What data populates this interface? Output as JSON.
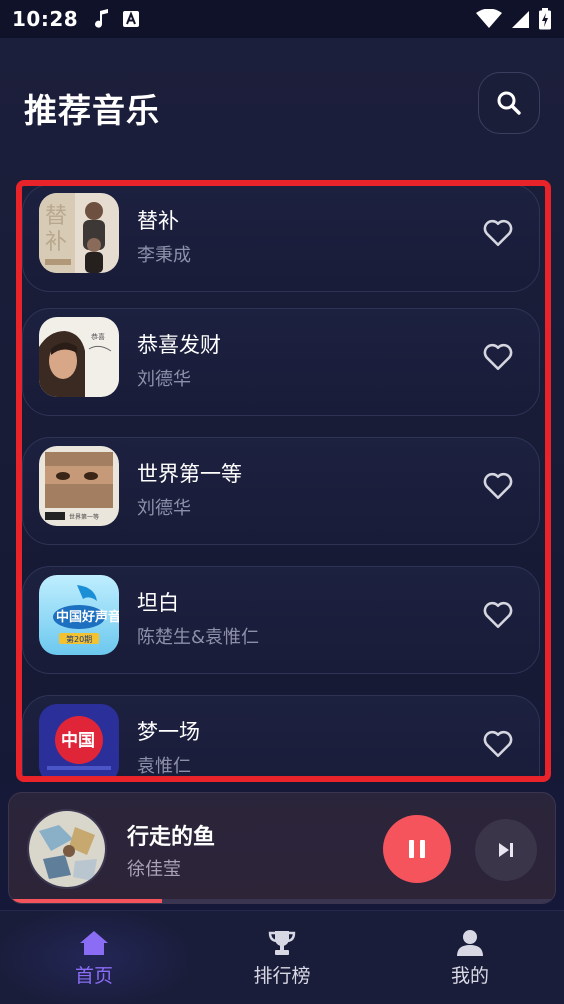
{
  "status_bar": {
    "time": "10:28",
    "left_icons": [
      "music-note-icon",
      "accessibility-a-icon"
    ],
    "right_icons": [
      "wifi-icon",
      "signal-icon",
      "battery-charging-icon"
    ]
  },
  "header": {
    "title": "推荐音乐",
    "search_icon": "search-icon"
  },
  "songs": [
    {
      "title": "替补",
      "artist": "李秉成",
      "favorited": false,
      "cover_colors": [
        "#c9b8a0",
        "#e9e2d6"
      ]
    },
    {
      "title": "恭喜发财",
      "artist": "刘德华",
      "favorited": false,
      "cover_colors": [
        "#f1eee8",
        "#3a2a22"
      ]
    },
    {
      "title": "世界第一等",
      "artist": "刘德华",
      "favorited": false,
      "cover_colors": [
        "#e8e2d6",
        "#8a6a50"
      ]
    },
    {
      "title": "坦白",
      "artist": "陈楚生&袁惟仁",
      "favorited": false,
      "cover_colors": [
        "#7ed6f2",
        "#1a7fc0"
      ]
    },
    {
      "title": "梦一场",
      "artist": "袁惟仁",
      "favorited": false,
      "cover_colors": [
        "#2a3aa8",
        "#e22a3a"
      ]
    }
  ],
  "player": {
    "title": "行走的鱼",
    "artist": "徐佳莹",
    "progress": 0.28,
    "accent": "#f5545c"
  },
  "nav": [
    {
      "label": "首页",
      "icon": "home-icon",
      "active": true
    },
    {
      "label": "排行榜",
      "icon": "trophy-icon",
      "active": false
    },
    {
      "label": "我的",
      "icon": "user-icon",
      "active": false
    }
  ],
  "colors": {
    "accent_purple": "#8a6cf5",
    "highlight_red": "#e8232a",
    "background": "#181a33"
  }
}
